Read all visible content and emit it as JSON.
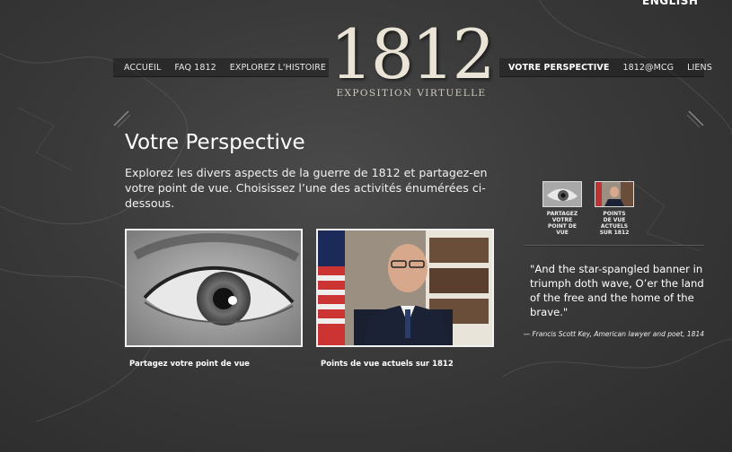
{
  "language_link": "ENGLISH",
  "nav": {
    "left": [
      {
        "label": "ACCUEIL"
      },
      {
        "label": "FAQ 1812"
      },
      {
        "label": "EXPLOREZ L'HISTOIRE"
      }
    ],
    "right": [
      {
        "label": "VOTRE PERSPECTIVE",
        "active": true
      },
      {
        "label": "1812@MCG"
      },
      {
        "label": "LIENS"
      }
    ]
  },
  "logo": {
    "year": "1812",
    "subtitle": "EXPOSITION VIRTUELLE"
  },
  "page": {
    "title": "Votre Perspective",
    "intro": "Explorez les divers aspects de la guerre de 1812 et partagez-en votre point de vue. Choisissez l’une des activités énumérées ci-dessous."
  },
  "cards": [
    {
      "caption": "Partagez votre point de vue",
      "icon": "eye-photo"
    },
    {
      "caption": "Points de vue actuels sur 1812",
      "icon": "speaker-photo"
    }
  ],
  "thumbnails": [
    {
      "label": "PARTAGEZ VOTRE POINT DE VUE"
    },
    {
      "label": "POINTS DE VUE ACTUELS SUR 1812"
    }
  ],
  "quote": {
    "text": "\"And the star-spangled banner in triumph doth wave, O’er the land of the free and the home of the brave.\"",
    "attribution": "— Francis Scott Key, American lawyer and poet, 1814"
  },
  "colors": {
    "background": "#3a3a3a",
    "logo": "#e9e4d6",
    "text": "#ffffff"
  }
}
